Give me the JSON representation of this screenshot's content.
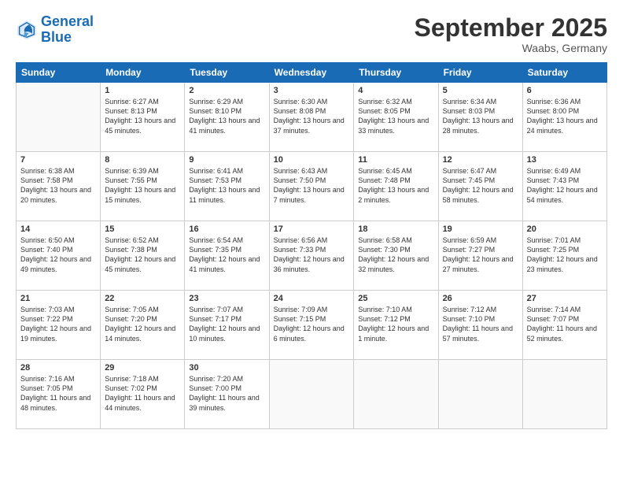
{
  "logo": {
    "line1": "General",
    "line2": "Blue"
  },
  "title": "September 2025",
  "location": "Waabs, Germany",
  "headers": [
    "Sunday",
    "Monday",
    "Tuesday",
    "Wednesday",
    "Thursday",
    "Friday",
    "Saturday"
  ],
  "weeks": [
    [
      {
        "day": "",
        "sunrise": "",
        "sunset": "",
        "daylight": ""
      },
      {
        "day": "1",
        "sunrise": "Sunrise: 6:27 AM",
        "sunset": "Sunset: 8:13 PM",
        "daylight": "Daylight: 13 hours and 45 minutes."
      },
      {
        "day": "2",
        "sunrise": "Sunrise: 6:29 AM",
        "sunset": "Sunset: 8:10 PM",
        "daylight": "Daylight: 13 hours and 41 minutes."
      },
      {
        "day": "3",
        "sunrise": "Sunrise: 6:30 AM",
        "sunset": "Sunset: 8:08 PM",
        "daylight": "Daylight: 13 hours and 37 minutes."
      },
      {
        "day": "4",
        "sunrise": "Sunrise: 6:32 AM",
        "sunset": "Sunset: 8:05 PM",
        "daylight": "Daylight: 13 hours and 33 minutes."
      },
      {
        "day": "5",
        "sunrise": "Sunrise: 6:34 AM",
        "sunset": "Sunset: 8:03 PM",
        "daylight": "Daylight: 13 hours and 28 minutes."
      },
      {
        "day": "6",
        "sunrise": "Sunrise: 6:36 AM",
        "sunset": "Sunset: 8:00 PM",
        "daylight": "Daylight: 13 hours and 24 minutes."
      }
    ],
    [
      {
        "day": "7",
        "sunrise": "Sunrise: 6:38 AM",
        "sunset": "Sunset: 7:58 PM",
        "daylight": "Daylight: 13 hours and 20 minutes."
      },
      {
        "day": "8",
        "sunrise": "Sunrise: 6:39 AM",
        "sunset": "Sunset: 7:55 PM",
        "daylight": "Daylight: 13 hours and 15 minutes."
      },
      {
        "day": "9",
        "sunrise": "Sunrise: 6:41 AM",
        "sunset": "Sunset: 7:53 PM",
        "daylight": "Daylight: 13 hours and 11 minutes."
      },
      {
        "day": "10",
        "sunrise": "Sunrise: 6:43 AM",
        "sunset": "Sunset: 7:50 PM",
        "daylight": "Daylight: 13 hours and 7 minutes."
      },
      {
        "day": "11",
        "sunrise": "Sunrise: 6:45 AM",
        "sunset": "Sunset: 7:48 PM",
        "daylight": "Daylight: 13 hours and 2 minutes."
      },
      {
        "day": "12",
        "sunrise": "Sunrise: 6:47 AM",
        "sunset": "Sunset: 7:45 PM",
        "daylight": "Daylight: 12 hours and 58 minutes."
      },
      {
        "day": "13",
        "sunrise": "Sunrise: 6:49 AM",
        "sunset": "Sunset: 7:43 PM",
        "daylight": "Daylight: 12 hours and 54 minutes."
      }
    ],
    [
      {
        "day": "14",
        "sunrise": "Sunrise: 6:50 AM",
        "sunset": "Sunset: 7:40 PM",
        "daylight": "Daylight: 12 hours and 49 minutes."
      },
      {
        "day": "15",
        "sunrise": "Sunrise: 6:52 AM",
        "sunset": "Sunset: 7:38 PM",
        "daylight": "Daylight: 12 hours and 45 minutes."
      },
      {
        "day": "16",
        "sunrise": "Sunrise: 6:54 AM",
        "sunset": "Sunset: 7:35 PM",
        "daylight": "Daylight: 12 hours and 41 minutes."
      },
      {
        "day": "17",
        "sunrise": "Sunrise: 6:56 AM",
        "sunset": "Sunset: 7:33 PM",
        "daylight": "Daylight: 12 hours and 36 minutes."
      },
      {
        "day": "18",
        "sunrise": "Sunrise: 6:58 AM",
        "sunset": "Sunset: 7:30 PM",
        "daylight": "Daylight: 12 hours and 32 minutes."
      },
      {
        "day": "19",
        "sunrise": "Sunrise: 6:59 AM",
        "sunset": "Sunset: 7:27 PM",
        "daylight": "Daylight: 12 hours and 27 minutes."
      },
      {
        "day": "20",
        "sunrise": "Sunrise: 7:01 AM",
        "sunset": "Sunset: 7:25 PM",
        "daylight": "Daylight: 12 hours and 23 minutes."
      }
    ],
    [
      {
        "day": "21",
        "sunrise": "Sunrise: 7:03 AM",
        "sunset": "Sunset: 7:22 PM",
        "daylight": "Daylight: 12 hours and 19 minutes."
      },
      {
        "day": "22",
        "sunrise": "Sunrise: 7:05 AM",
        "sunset": "Sunset: 7:20 PM",
        "daylight": "Daylight: 12 hours and 14 minutes."
      },
      {
        "day": "23",
        "sunrise": "Sunrise: 7:07 AM",
        "sunset": "Sunset: 7:17 PM",
        "daylight": "Daylight: 12 hours and 10 minutes."
      },
      {
        "day": "24",
        "sunrise": "Sunrise: 7:09 AM",
        "sunset": "Sunset: 7:15 PM",
        "daylight": "Daylight: 12 hours and 6 minutes."
      },
      {
        "day": "25",
        "sunrise": "Sunrise: 7:10 AM",
        "sunset": "Sunset: 7:12 PM",
        "daylight": "Daylight: 12 hours and 1 minute."
      },
      {
        "day": "26",
        "sunrise": "Sunrise: 7:12 AM",
        "sunset": "Sunset: 7:10 PM",
        "daylight": "Daylight: 11 hours and 57 minutes."
      },
      {
        "day": "27",
        "sunrise": "Sunrise: 7:14 AM",
        "sunset": "Sunset: 7:07 PM",
        "daylight": "Daylight: 11 hours and 52 minutes."
      }
    ],
    [
      {
        "day": "28",
        "sunrise": "Sunrise: 7:16 AM",
        "sunset": "Sunset: 7:05 PM",
        "daylight": "Daylight: 11 hours and 48 minutes."
      },
      {
        "day": "29",
        "sunrise": "Sunrise: 7:18 AM",
        "sunset": "Sunset: 7:02 PM",
        "daylight": "Daylight: 11 hours and 44 minutes."
      },
      {
        "day": "30",
        "sunrise": "Sunrise: 7:20 AM",
        "sunset": "Sunset: 7:00 PM",
        "daylight": "Daylight: 11 hours and 39 minutes."
      },
      {
        "day": "",
        "sunrise": "",
        "sunset": "",
        "daylight": ""
      },
      {
        "day": "",
        "sunrise": "",
        "sunset": "",
        "daylight": ""
      },
      {
        "day": "",
        "sunrise": "",
        "sunset": "",
        "daylight": ""
      },
      {
        "day": "",
        "sunrise": "",
        "sunset": "",
        "daylight": ""
      }
    ]
  ]
}
